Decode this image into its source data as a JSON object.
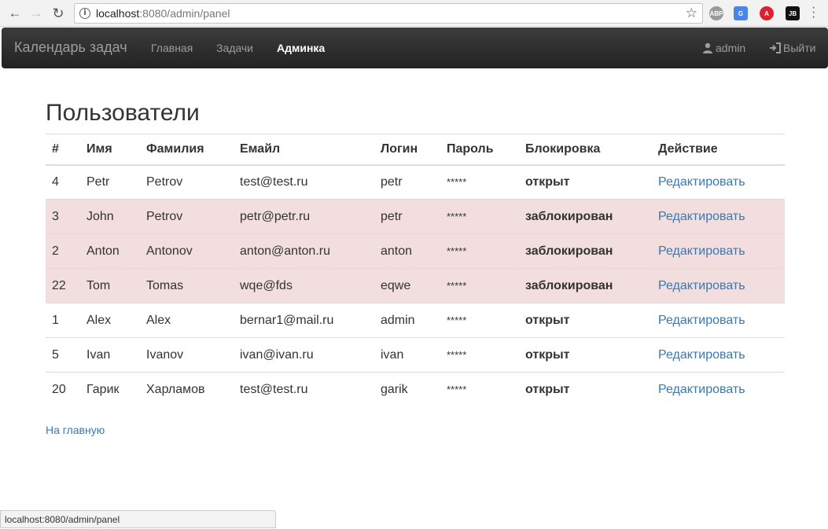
{
  "browser": {
    "url_host": "localhost",
    "url_rest": ":8080/admin/panel",
    "status_url": "localhost:8080/admin/panel",
    "extensions": [
      "ABP",
      "G",
      "A",
      "JB"
    ]
  },
  "navbar": {
    "brand": "Календарь задач",
    "links": [
      "Главная",
      "Задачи",
      "Админка"
    ],
    "user": "admin",
    "logout": "Выйти"
  },
  "page": {
    "title": "Пользователи",
    "home_link": "На главную"
  },
  "table": {
    "headers": [
      "#",
      "Имя",
      "Фамилия",
      "Емайл",
      "Логин",
      "Пароль",
      "Блокировка",
      "Действие"
    ],
    "rows": [
      {
        "id": "4",
        "first": "Petr",
        "last": "Petrov",
        "email": "test@test.ru",
        "login": "petr",
        "password": "*****",
        "status": "открыт",
        "blocked": false,
        "action": "Редактировать"
      },
      {
        "id": "3",
        "first": "John",
        "last": "Petrov",
        "email": "petr@petr.ru",
        "login": "petr",
        "password": "*****",
        "status": "заблокирован",
        "blocked": true,
        "action": "Редактировать"
      },
      {
        "id": "2",
        "first": "Anton",
        "last": "Antonov",
        "email": "anton@anton.ru",
        "login": "anton",
        "password": "*****",
        "status": "заблокирован",
        "blocked": true,
        "action": "Редактировать"
      },
      {
        "id": "22",
        "first": "Tom",
        "last": "Tomas",
        "email": "wqe@fds",
        "login": "eqwe",
        "password": "*****",
        "status": "заблокирован",
        "blocked": true,
        "action": "Редактировать"
      },
      {
        "id": "1",
        "first": "Alex",
        "last": "Alex",
        "email": "bernar1@mail.ru",
        "login": "admin",
        "password": "*****",
        "status": "открыт",
        "blocked": false,
        "action": "Редактировать"
      },
      {
        "id": "5",
        "first": "Ivan",
        "last": "Ivanov",
        "email": "ivan@ivan.ru",
        "login": "ivan",
        "password": "*****",
        "status": "открыт",
        "blocked": false,
        "action": "Редактировать"
      },
      {
        "id": "20",
        "first": "Гарик",
        "last": "Харламов",
        "email": "test@test.ru",
        "login": "garik",
        "password": "*****",
        "status": "открыт",
        "blocked": false,
        "action": "Редактировать"
      }
    ]
  },
  "colors": {
    "blocked_row": "#f2dede",
    "link": "#337ab7",
    "navbar": "#222222"
  }
}
